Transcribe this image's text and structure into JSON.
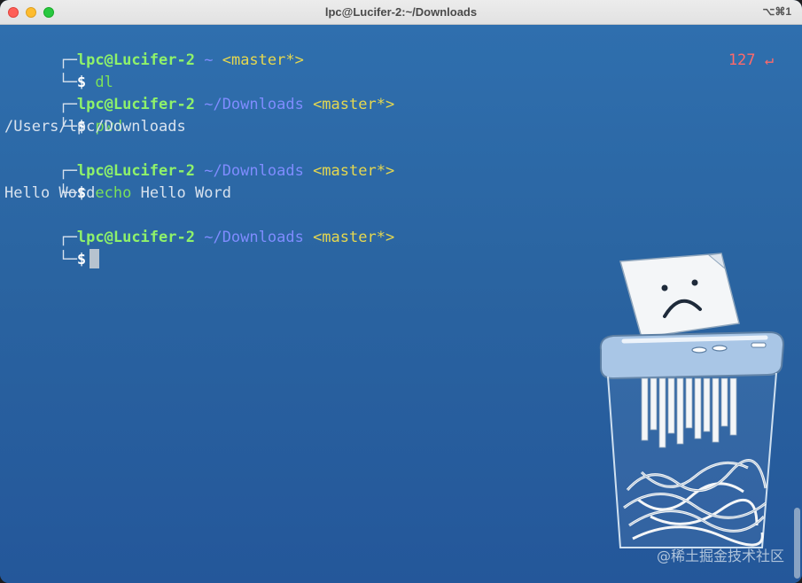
{
  "window": {
    "title": "lpc@Lucifer-2:~/Downloads",
    "shortcut": "⌥⌘1"
  },
  "terminal": {
    "lines": [
      {
        "type": "prompt",
        "user": "lpc@Lucifer-2",
        "path": "~",
        "branch": "<master*>"
      },
      {
        "type": "command",
        "cmd": "dl",
        "args": ""
      },
      {
        "type": "prompt",
        "user": "lpc@Lucifer-2",
        "path": "~/Downloads",
        "branch": "<master*>"
      },
      {
        "type": "command",
        "cmd": "pwd",
        "args": ""
      },
      {
        "type": "output",
        "text": "/Users/lpc/Downloads"
      },
      {
        "type": "prompt",
        "user": "lpc@Lucifer-2",
        "path": "~/Downloads",
        "branch": "<master*>"
      },
      {
        "type": "command",
        "cmd": "echo",
        "args": " Hello Word"
      },
      {
        "type": "output",
        "text": "Hello Word"
      },
      {
        "type": "prompt",
        "user": "lpc@Lucifer-2",
        "path": "~/Downloads",
        "branch": "<master*>"
      },
      {
        "type": "command",
        "cmd": "",
        "args": ""
      }
    ],
    "return_code": "127 ↵",
    "prompt_corner_top": "┌─",
    "prompt_corner_bottom": "└─",
    "dollar": "$"
  },
  "watermark": "@稀土掘金技术社区",
  "colors": {
    "background": "#2a65a3",
    "user": "#8ff26a",
    "path": "#7f8cff",
    "branch": "#e6d84f",
    "command": "#7be05a",
    "error": "#ff6a6a"
  },
  "icons": {
    "background_art": "sad-paper-shredder-icon"
  }
}
